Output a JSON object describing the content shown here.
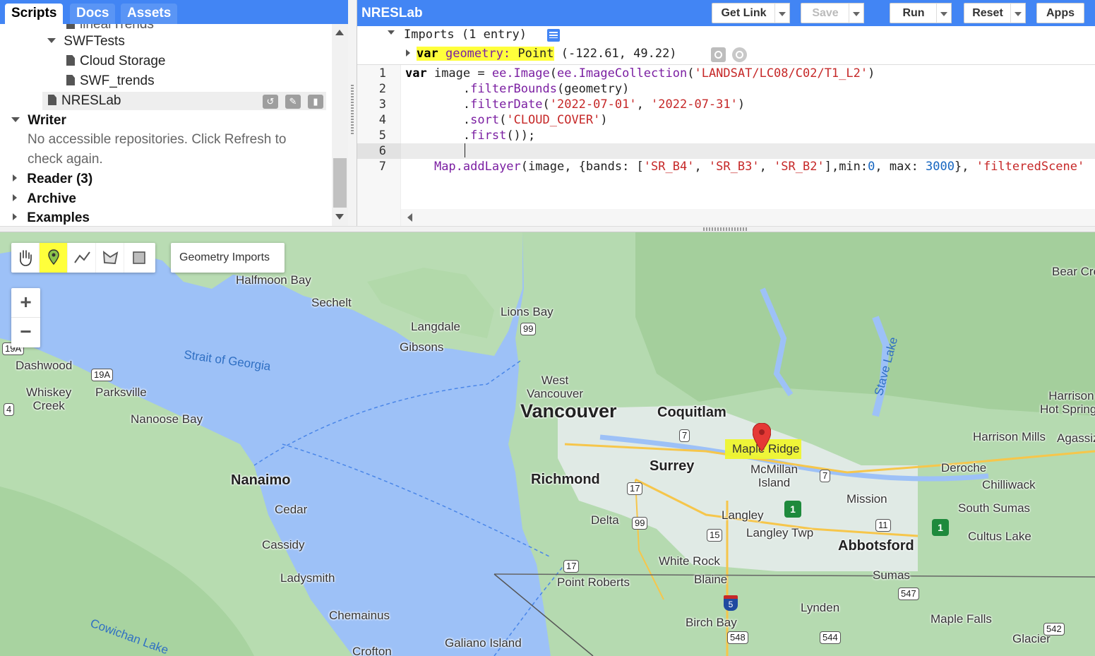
{
  "left_panel": {
    "tabs": [
      {
        "label": "Scripts",
        "active": true
      },
      {
        "label": "Docs",
        "active": false
      },
      {
        "label": "Assets",
        "active": false
      }
    ],
    "tree": {
      "partial_item": "linearTrends",
      "folder": "SWFTests",
      "files": [
        "Cloud Storage",
        "SWF_trends"
      ],
      "selected_script": "NRESLab",
      "writer_label": "Writer",
      "writer_message": "No accessible repositories. Click Refresh to check again.",
      "reader_label": "Reader (3)",
      "archive_label": "Archive",
      "examples_label": "Examples"
    }
  },
  "editor": {
    "script_title": "NRESLab",
    "buttons": {
      "get_link": "Get Link",
      "save": "Save",
      "run": "Run",
      "reset": "Reset",
      "apps": "Apps"
    },
    "imports": {
      "header": "Imports (1 entry)",
      "var_kw": "var",
      "var_name": "geometry:",
      "var_type": "Point",
      "var_value": "(-122.61, 49.22)"
    },
    "line_numbers": [
      "1",
      "2",
      "3",
      "4",
      "5",
      "6",
      "7"
    ],
    "code": {
      "l1_a": "var",
      "l1_b": " image = ",
      "l1_c": "ee.Image",
      "l1_d": "(",
      "l1_e": "ee.ImageCollection",
      "l1_f": "(",
      "l1_g": "'LANDSAT/LC08/C02/T1_L2'",
      "l1_h": ")",
      "l2_a": "        .",
      "l2_b": "filterBounds",
      "l2_c": "(geometry)",
      "l3_a": "        .",
      "l3_b": "filterDate",
      "l3_c": "(",
      "l3_d": "'2022-07-01'",
      "l3_e": ", ",
      "l3_f": "'2022-07-31'",
      "l3_g": ")",
      "l4_a": "        .",
      "l4_b": "sort",
      "l4_c": "(",
      "l4_d": "'CLOUD_COVER'",
      "l4_e": ")",
      "l5_a": "        .",
      "l5_b": "first",
      "l5_c": "());",
      "l7_a": "    ",
      "l7_b": "Map.addLayer",
      "l7_c": "(image, {bands: [",
      "l7_d": "'SR_B4'",
      "l7_e": ", ",
      "l7_f": "'SR_B3'",
      "l7_g": ", ",
      "l7_h": "'SR_B2'",
      "l7_i": "],min:",
      "l7_j": "0",
      "l7_k": ", max: ",
      "l7_l": "3000",
      "l7_m": "}, ",
      "l7_n": "'filteredScene'"
    }
  },
  "map": {
    "geometry_imports": "Geometry Imports",
    "zoom_in": "+",
    "zoom_out": "−",
    "labels": {
      "halfmoon_bay": "Halfmoon Bay",
      "sechelt": "Sechelt",
      "lions_bay": "Lions Bay",
      "langdale": "Langdale",
      "gibsons": "Gibsons",
      "strait": "Strait of Georgia",
      "dashwood": "Dashwood",
      "whiskey_creek": "Whiskey\nCreek",
      "parksville": "Parksville",
      "nanoose_bay": "Nanoose Bay",
      "nanaimo": "Nanaimo",
      "cedar": "Cedar",
      "cassidy": "Cassidy",
      "ladysmith": "Ladysmith",
      "chemainus": "Chemainus",
      "crofton": "Crofton",
      "galiano": "Galiano Island",
      "cowichan": "Cowichan Lake",
      "west_vancouver": "West\nVancouver",
      "vancouver": "Vancouver",
      "coquitlam": "Coquitlam",
      "richmond": "Richmond",
      "surrey": "Surrey",
      "maple_ridge": "Maple Ridge",
      "mcmillan": "McMillan\nIsland",
      "delta": "Delta",
      "langley": "Langley",
      "langley_twp": "Langley Twp",
      "white_rock": "White Rock",
      "point_roberts": "Point Roberts",
      "blaine": "Blaine",
      "birch_bay": "Birch Bay",
      "lynden": "Lynden",
      "mission": "Mission",
      "abbotsford": "Abbotsford",
      "sumas": "Sumas",
      "deroche": "Deroche",
      "chilliwack": "Chilliwack",
      "south_sumas": "South Sumas",
      "cultus_lake": "Cultus Lake",
      "harrison_mills": "Harrison Mills",
      "agassiz": "Agassiz",
      "harrison_hot": "Harrison\nHot Springs",
      "bear_creek": "Bear Creek",
      "stave_lake": "Stave Lake",
      "maple_falls": "Maple Falls",
      "glacier": "Glacier"
    },
    "shields": {
      "r99": "99",
      "r19a_a": "19A",
      "r19a_b": "19A",
      "r4": "4",
      "r7a": "7",
      "r7b": "7",
      "r17a": "17",
      "r17b": "17",
      "r99b": "99",
      "r15": "15",
      "r11": "11",
      "r5": "5",
      "r548": "548",
      "r544": "544",
      "r547": "547",
      "r542": "542",
      "r1a": "1",
      "r1b": "1"
    }
  }
}
